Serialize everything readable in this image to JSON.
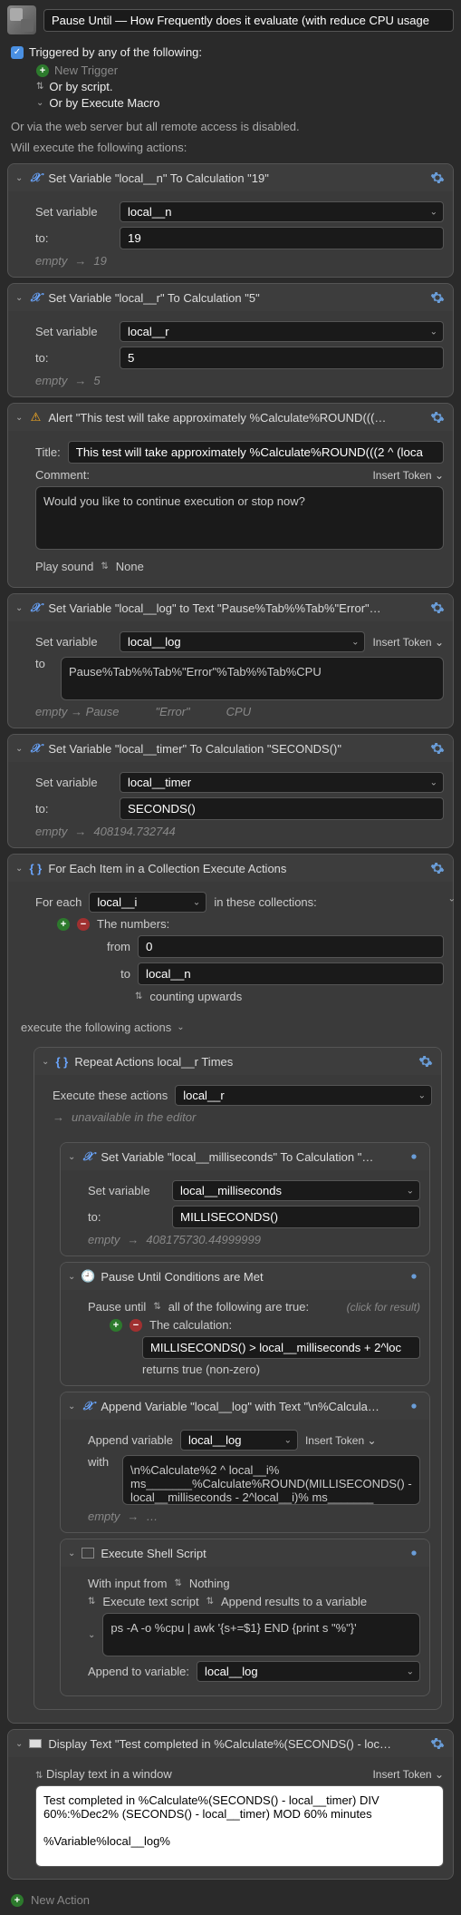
{
  "header": {
    "title": "Pause Until — How Frequently does it evaluate (with reduce CPU usage"
  },
  "triggers": {
    "heading": "Triggered by any of the following:",
    "new_trigger": "New Trigger",
    "or_script": "Or by script.",
    "or_execute_macro": "Or by Execute Macro",
    "webserver": "Or via the web server but all remote access is disabled."
  },
  "exec_heading": "Will execute the following actions:",
  "actions": {
    "setvar_n": {
      "title": "Set Variable \"local__n\" To Calculation \"19\"",
      "label_var": "Set variable",
      "var_name": "local__n",
      "label_to": "to:",
      "value": "19",
      "empty": "empty",
      "result": "19"
    },
    "setvar_r": {
      "title": "Set Variable \"local__r\" To Calculation \"5\"",
      "label_var": "Set variable",
      "var_name": "local__r",
      "label_to": "to:",
      "value": "5",
      "empty": "empty",
      "result": "5"
    },
    "alert": {
      "title": "Alert \"This test will take approximately %Calculate%ROUND(((…",
      "label_title": "Title:",
      "title_value": "This test will take approximately %Calculate%ROUND(((2 ^ (loca",
      "label_comment": "Comment:",
      "insert_token": "Insert Token",
      "comment_value": "Would you like to continue execution or stop now?",
      "play_sound": "Play sound",
      "sound_value": "None"
    },
    "setvar_log": {
      "title": "Set Variable \"local__log\" to Text \"Pause%Tab%%Tab%\"Error\"…",
      "label_var": "Set variable",
      "var_name": "local__log",
      "insert_token": "Insert Token",
      "label_to": "to",
      "value": "Pause%Tab%%Tab%\"Error\"%Tab%%Tab%CPU",
      "empty": "empty",
      "result_pause": "Pause",
      "result_error": "\"Error\"",
      "result_cpu": "CPU"
    },
    "setvar_timer": {
      "title": "Set Variable \"local__timer\" To Calculation \"SECONDS()\"",
      "label_var": "Set variable",
      "var_name": "local__timer",
      "label_to": "to:",
      "value": "SECONDS()",
      "empty": "empty",
      "result": "408194.732744"
    },
    "foreach": {
      "title": "For Each Item in a Collection Execute Actions",
      "label_foreach": "For each",
      "var_name": "local__i",
      "in_collections": "in these collections:",
      "numbers_label": "The numbers:",
      "from_label": "from",
      "from_value": "0",
      "to_label": "to",
      "to_value": "local__n",
      "counting": "counting upwards",
      "exec_label": "execute the following actions",
      "repeat": {
        "title": "Repeat Actions local__r Times",
        "exec_label": "Execute these actions",
        "var_name": "local__r",
        "unavailable": "unavailable in the editor",
        "setvar_ms": {
          "title": "Set Variable \"local__milliseconds\" To Calculation \"…",
          "label_var": "Set variable",
          "var_name": "local__milliseconds",
          "label_to": "to:",
          "value": "MILLISECONDS()",
          "empty": "empty",
          "result": "408175730.44999999"
        },
        "pause": {
          "title": "Pause Until Conditions are Met",
          "pause_label": "Pause until",
          "condition_type": "all of the following are true:",
          "click_result": "(click for result)",
          "calc_label": "The calculation:",
          "calc_expr": "MILLISECONDS() > local__milliseconds + 2^loc",
          "returns": "returns true (non-zero)"
        },
        "append": {
          "title": "Append Variable \"local__log\" with Text \"\\n%Calcula…",
          "label_var": "Append variable",
          "var_name": "local__log",
          "insert_token": "Insert Token",
          "label_with": "with",
          "value": "\\n%Calculate%2 ^ local__i% ms_______%Calculate%ROUND(MILLISECONDS() - local__milliseconds - 2^local__i)% ms_______",
          "empty": "empty",
          "result": "…"
        },
        "shell": {
          "title": "Execute Shell Script",
          "input_label": "With input from",
          "input_value": "Nothing",
          "exec_type": "Execute text script",
          "append_type": "Append results to a variable",
          "script": "ps -A -o %cpu | awk '{s+=$1} END {print s \"%\"}'",
          "append_label": "Append to variable:",
          "append_var": "local__log"
        }
      }
    },
    "display": {
      "title": "Display Text \"Test completed in %Calculate%(SECONDS() - loc…",
      "display_label": "Display text in a window",
      "insert_token": "Insert Token",
      "text": "Test completed in %Calculate%(SECONDS() - local__timer) DIV 60%:%Dec2% (SECONDS() - local__timer) MOD 60% minutes\n\n%Variable%local__log%"
    }
  },
  "new_action": "New Action"
}
